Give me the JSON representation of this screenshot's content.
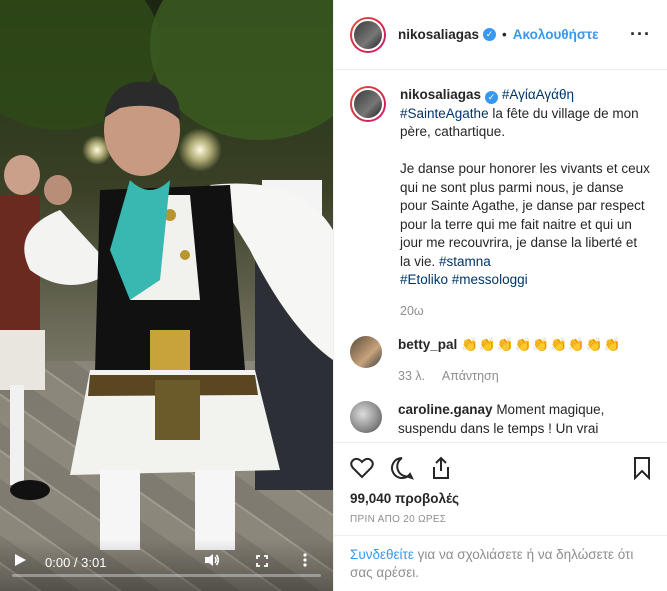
{
  "video": {
    "time_display": "0:00 / 3:01",
    "progress": 0,
    "icons": {
      "play": "play-icon",
      "volume": "volume-icon",
      "fullscreen": "fullscreen-icon",
      "more": "more-vertical-icon"
    }
  },
  "header": {
    "username": "nikosaliagas",
    "follow_label": "Ακολουθήστε",
    "dot": "•",
    "more_label": "···"
  },
  "caption": {
    "username": "nikosaliagas",
    "tag1": "#ΑγίαΑγάθη",
    "tag2": "#SainteAgathe",
    "text1": " la fête du village de mon père, cathartique.\n\nJe danse pour honorer les vivants et ceux qui ne sont plus parmi nous, je danse pour Sainte Agathe, je danse par respect pour la terre qui me fait naitre et qui un jour me recouvrira, je danse la liberté et la vie. ",
    "tag3": "#stamna",
    "tag4": "#Etoliko",
    "tag5": "#messologgi",
    "age": "20ω"
  },
  "comments": [
    {
      "username": "betty_pal",
      "text": "👏👏👏👏👏👏👏👏👏",
      "age": "33 λ.",
      "reply": "Απάντηση"
    },
    {
      "username": "caroline.ganay",
      "text": "Moment magique, suspendu dans le temps ! Un vrai"
    }
  ],
  "actions": {
    "views": "99,040 προβολές",
    "ago": "ΠΡΙΝ ΑΠΟ 20 ΩΡΕΣ"
  },
  "login": {
    "link": "Συνδεθείτε",
    "rest": " για να σχολιάσετε ή να δηλώσετε ότι σας αρέσει."
  },
  "colors": {
    "accent": "#3897f0",
    "hashtag": "#003569",
    "muted": "#8e8e8e"
  }
}
